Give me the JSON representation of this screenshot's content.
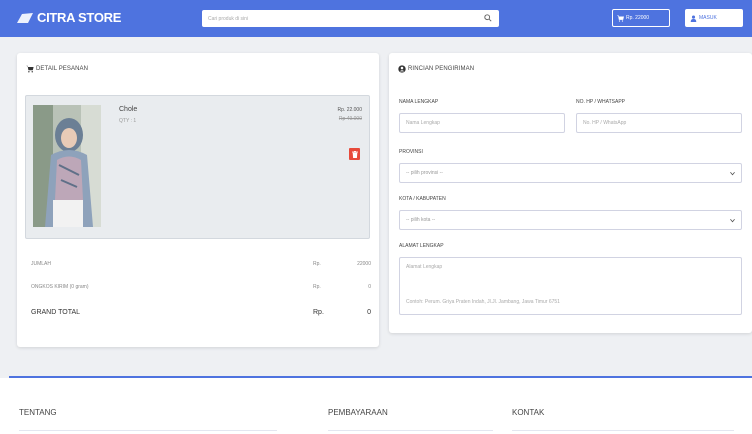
{
  "navbar": {
    "brand": "CITRA STORE",
    "search_placeholder": "Cari produk di sini",
    "cart_label": "Rp. 22000",
    "login_label": "MASUK"
  },
  "order": {
    "title": "DETAIL PESANAN",
    "product": {
      "name": "Chole",
      "qty": "QTY : 1",
      "price": "Rp. 22.000",
      "original_price": "Rp 49.000"
    },
    "summary": [
      {
        "label": "JUMLAH",
        "currency": "Rp.",
        "value": "22000"
      },
      {
        "label": "ONGKOS KIRIM (0 gram)",
        "currency": "Rp.",
        "value": "0"
      }
    ],
    "grand_total": {
      "label": "GRAND TOTAL",
      "currency": "Rp.",
      "value": "0"
    }
  },
  "shipping": {
    "title": "RINCIAN PENGIRIMAN",
    "name_label": "NAMA LENGKAP",
    "name_placeholder": "Nama Lengkap",
    "phone_label": "NO. HP / WHATSAPP",
    "phone_placeholder": "No. HP / WhatsApp",
    "province_label": "PROVINSI",
    "province_value": "-- pilih provinsi --",
    "city_label": "KOTA / KABUPATEN",
    "city_value": "-- pilih kota --",
    "address_label": "ALAMAT LENGKAP",
    "address_placeholder": "Alamat Lengkap",
    "address_hint": "Contoh: Perum. Griya Praten Indah, Jl.Jl. Jambang, Jawa Timur 6751"
  },
  "footer": {
    "about": "TENTANG",
    "payment": "PEMBAYARAAN",
    "contact": "KONTAK"
  },
  "colors": {
    "primary": "#4e73df",
    "danger": "#e74a3b"
  }
}
